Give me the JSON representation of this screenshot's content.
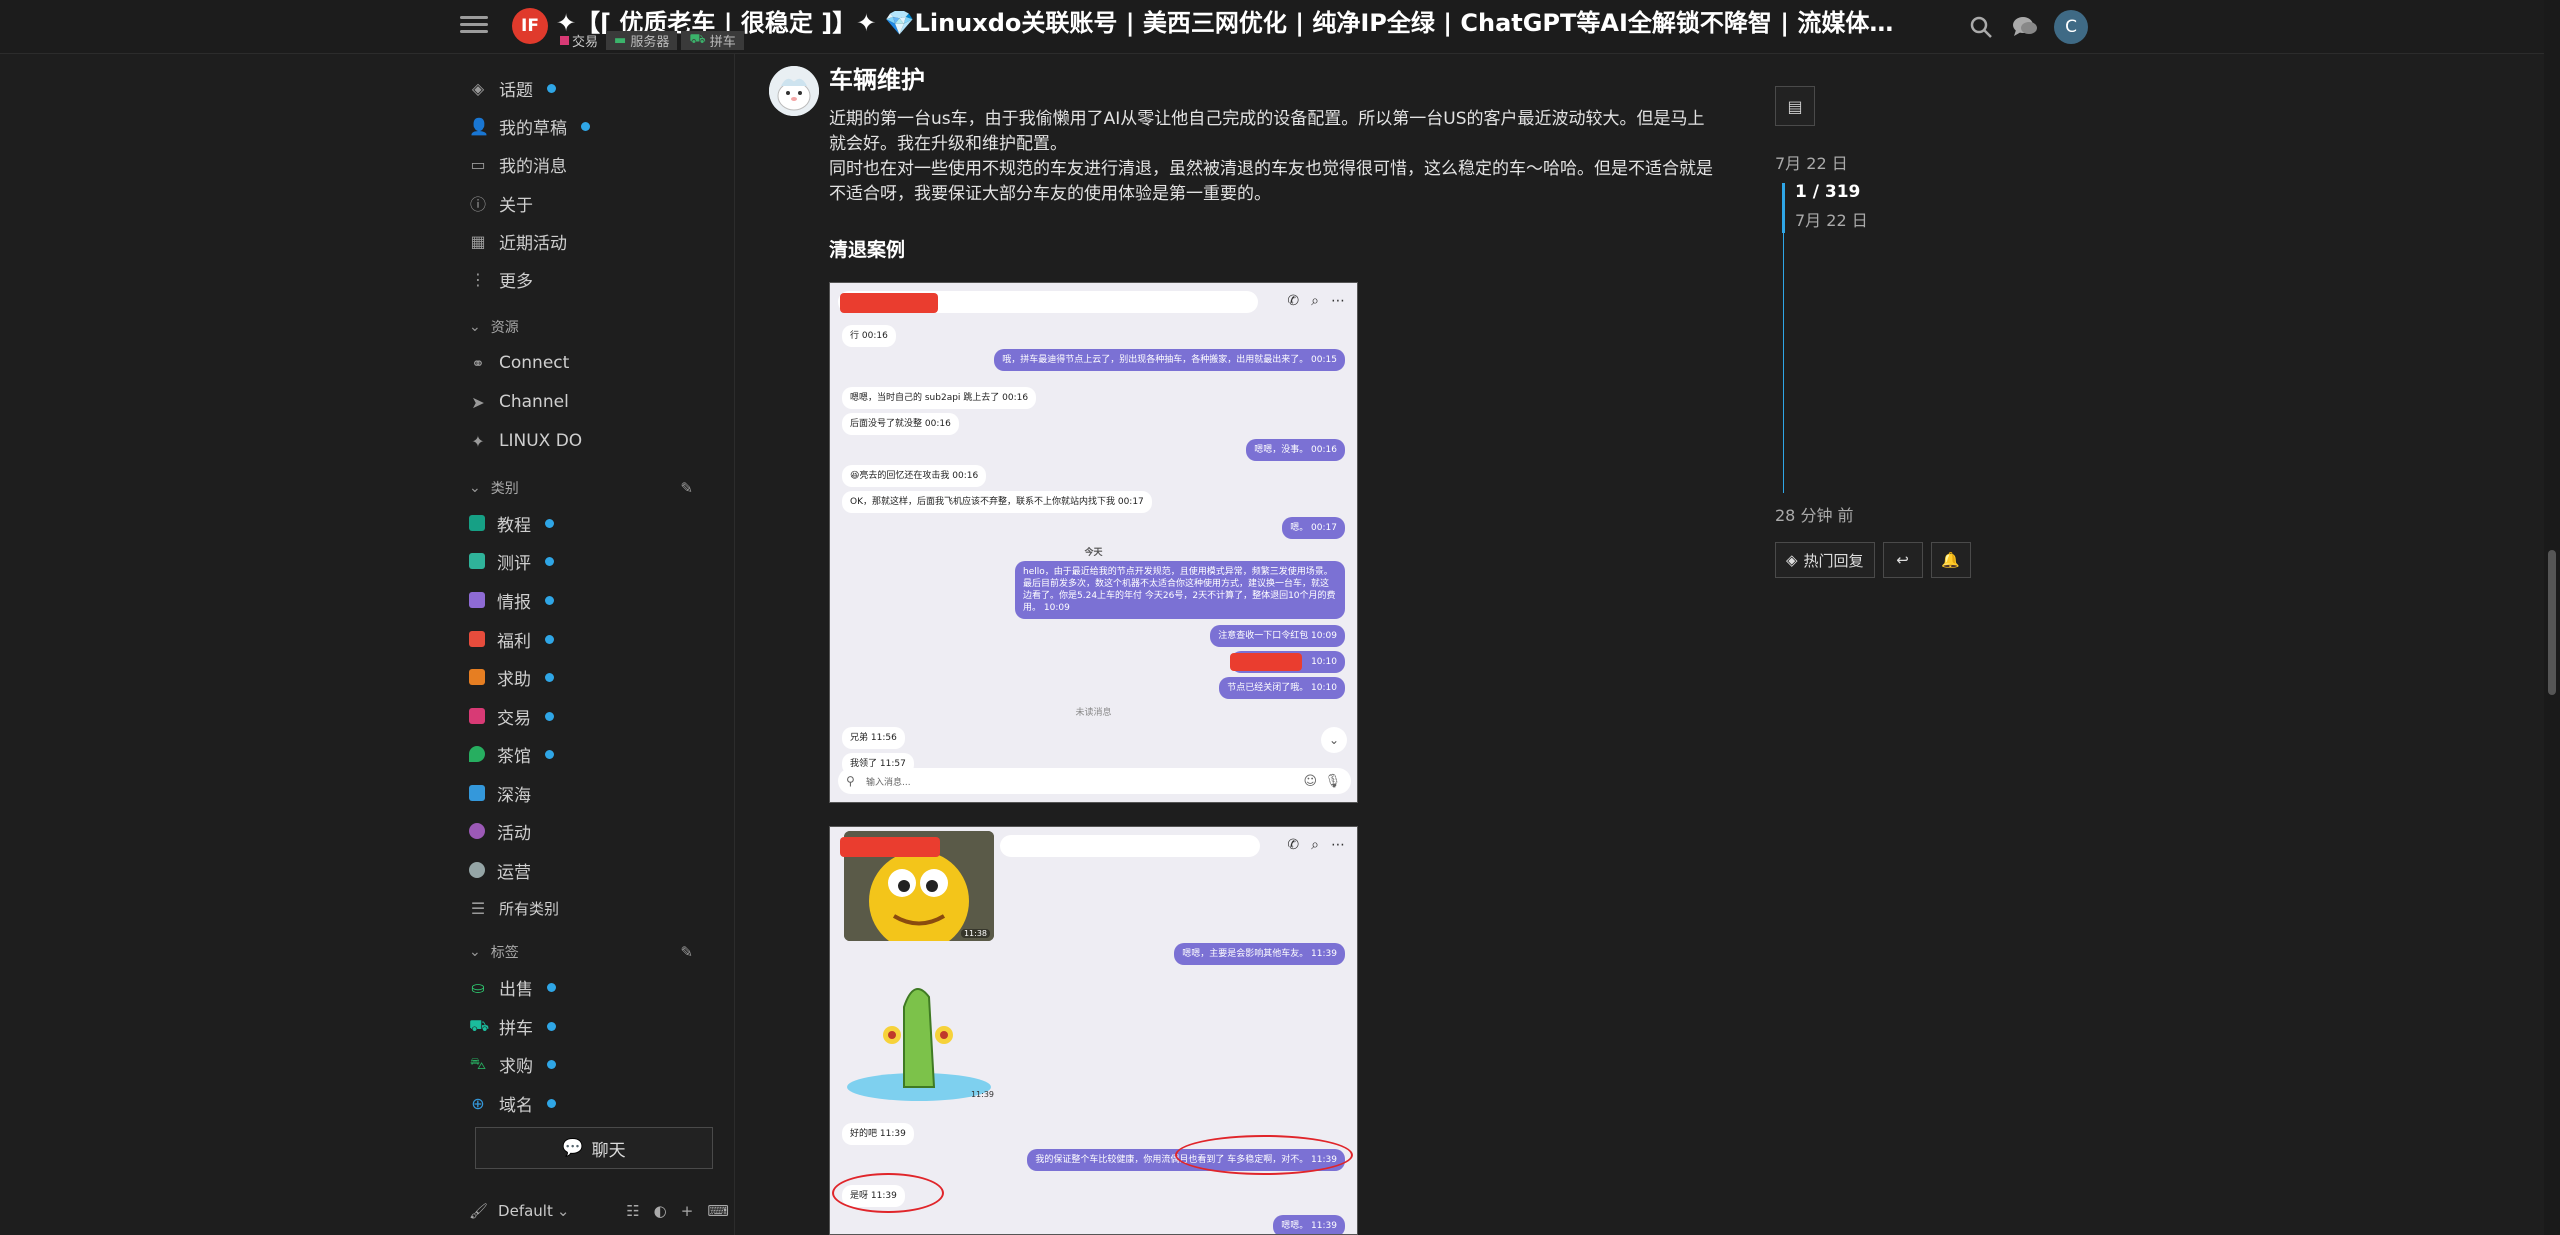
{
  "header": {
    "logo_text": "IF",
    "title": "✦【[ 优质老车 | 很稳定 ]】✦ 💎Linuxdo关联账号 | 美西三网优化 | 纯净IP全绿 | ChatGPT等AI全解锁不降智 | 流媒体全解锁 | 小白很...",
    "category": "交易",
    "tags": [
      "服务器",
      "拼车"
    ],
    "avatar_letter": "C"
  },
  "sidebar": {
    "top_items": [
      {
        "label": "话题",
        "icon": "layers-icon"
      },
      {
        "label": "我的草稿",
        "icon": "user-icon"
      },
      {
        "label": "我的消息",
        "icon": "inbox-icon"
      },
      {
        "label": "关于",
        "icon": "info-icon"
      },
      {
        "label": "近期活动",
        "icon": "calendar-icon"
      },
      {
        "label": "更多",
        "icon": "more-vertical-icon"
      }
    ],
    "resources_title": "资源",
    "resources": [
      {
        "label": "Connect",
        "icon": "link-icon"
      },
      {
        "label": "Channel",
        "icon": "telegram-icon"
      },
      {
        "label": "LINUX DO",
        "icon": "sparkle-icon"
      }
    ],
    "categories_title": "类别",
    "categories": [
      {
        "label": "教程",
        "color": "#16a085"
      },
      {
        "label": "测评",
        "color": "#2fb39a"
      },
      {
        "label": "情报",
        "color": "#8e6bd4"
      },
      {
        "label": "福利",
        "color": "#e74c3c"
      },
      {
        "label": "求助",
        "color": "#e67e22"
      },
      {
        "label": "交易",
        "color": "#d83a75"
      },
      {
        "label": "茶馆",
        "color": "#27ae60"
      },
      {
        "label": "深海",
        "color": "#3498db"
      },
      {
        "label": "活动",
        "color": "#9b59b6"
      },
      {
        "label": "运营",
        "color": "#95a5a6"
      }
    ],
    "all_categories": "所有类别",
    "tags_title": "标签",
    "tags": [
      {
        "label": "出售",
        "color": "#2ecc71"
      },
      {
        "label": "拼车",
        "color": "#1abc9c"
      },
      {
        "label": "求购",
        "color": "#27ae60"
      },
      {
        "label": "域名",
        "color": "#3498db"
      }
    ],
    "chat_button": "聊天",
    "footer_default": "Default"
  },
  "post": {
    "heading": "车辆维护",
    "paragraph1": "近期的第一台us车，由于我偷懒用了AI从零让他自己完成的设备配置。所以第一台US的客户最近波动较大。但是马上就会好。我在升级和维护配置。",
    "paragraph2": "同时也在对一些使用不规范的车友进行清退，虽然被清退的车友也觉得很可惜，这么稳定的车～哈哈。但是不适合就是不适合呀，我要保证大部分车友的使用体验是第一重要的。",
    "subheading": "清退案例"
  },
  "shot1": {
    "msgs": [
      {
        "dir": "in",
        "text": "行 00:16"
      },
      {
        "dir": "out",
        "text": "哦，拼车最迪得节点上云了，别出现各种抽车，各种搬家，出用就最出来了。 00:15"
      },
      {
        "dir": "in",
        "text": "嗯嗯，当时自己的 sub2api 跳上去了 00:16"
      },
      {
        "dir": "in",
        "text": "后面没号了就没整 00:16"
      },
      {
        "dir": "out",
        "text": "嗯嗯，没事。 00:16"
      },
      {
        "dir": "in",
        "text": "😆亮去的回忆还在攻击我 00:16"
      },
      {
        "dir": "in",
        "text": "OK，那就这样，后面我飞机应该不弃整，联系不上你就站内找下我 00:17"
      },
      {
        "dir": "out",
        "text": "嗯。 00:17"
      },
      {
        "dir": "out",
        "text": "hello，由于最近给我的节点开发规范，且使用模式异常，频繁三发使用场景。最后目前发多次，数这个机器不太适合你这种使用方式，建议换一台车，就这边看了。你是5.24上车的年付 今天26号，2天不计算了，整体退回10个月的费用。 10:09"
      },
      {
        "dir": "out",
        "text": "注意查收一下口令红包 10:09"
      },
      {
        "dir": "out",
        "text": "10:10"
      },
      {
        "dir": "out",
        "text": "节点已经关闭了哦。 10:10"
      },
      {
        "dir": "in",
        "text": "兄弟 11:56"
      },
      {
        "dir": "in",
        "text": "我领了 11:57"
      }
    ],
    "today": "今天",
    "unread": "未读消息",
    "input_placeholder": "输入消息..."
  },
  "shot2": {
    "msgs": [
      {
        "dir": "out",
        "text": "嗯嗯，主要是会影响其他车友。 11:39"
      },
      {
        "dir": "in",
        "text": "好的吧 11:39"
      },
      {
        "dir": "out",
        "text": "我的保证整个车比较健康，你用流偶月也看到了 车多稳定啊，对不。 11:39"
      },
      {
        "dir": "in",
        "text": "是呀 11:39"
      },
      {
        "dir": "out",
        "text": "嗯嗯。 11:39"
      }
    ],
    "sticker_time1": "11:38",
    "sticker_time2": "11:39"
  },
  "timeline": {
    "date_top": "7月 22 日",
    "count": "1 / 319",
    "count_date": "7月 22 日",
    "date_bottom": "28 分钟 前",
    "hot_replies": "热门回复"
  }
}
